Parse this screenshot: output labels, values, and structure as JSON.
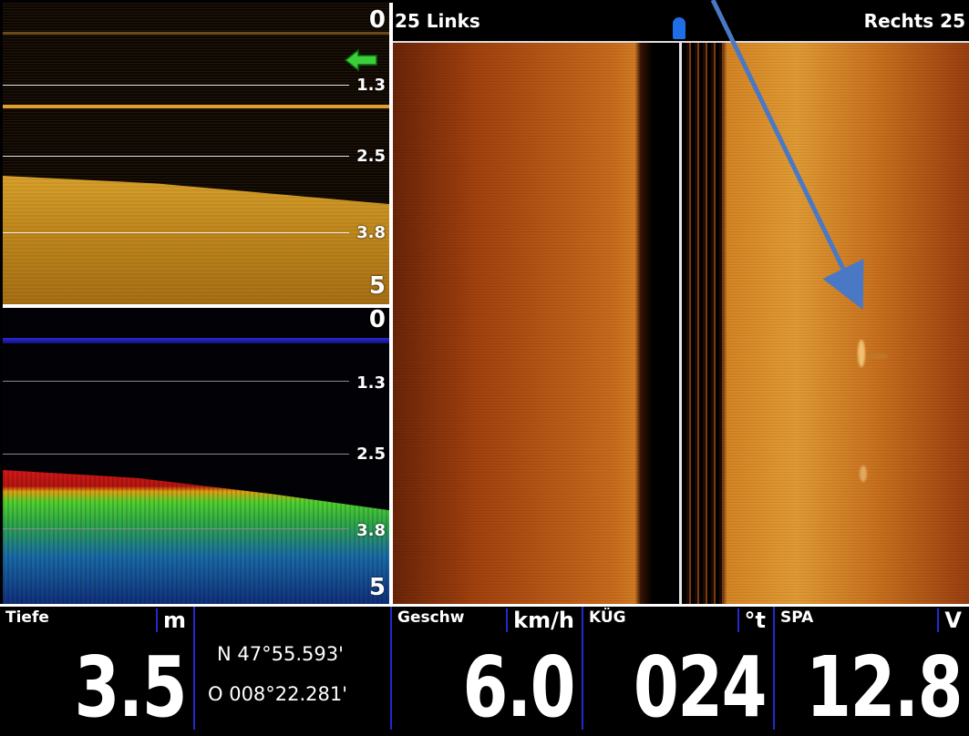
{
  "side_imaging": {
    "left_label": "25 Links",
    "right_label": "Rechts 25"
  },
  "down_imaging": {
    "depth_labels": [
      "0",
      "1.3",
      "2.5",
      "3.8",
      "5"
    ]
  },
  "sonar_2d": {
    "depth_labels": [
      "0",
      "1.3",
      "2.5",
      "3.8",
      "5"
    ]
  },
  "data_bar": {
    "depth": {
      "title": "Tiefe",
      "unit": "m",
      "value": "3.5"
    },
    "position": {
      "lat": "N 47°55.593'",
      "lon": "O 008°22.281'"
    },
    "speed": {
      "title": "Geschw",
      "unit": "km/h",
      "value": "6.0"
    },
    "course": {
      "title": "KÜG",
      "unit": "°t",
      "value": "024"
    },
    "voltage": {
      "title": "SPA",
      "unit": "V",
      "value": "12.8"
    }
  },
  "colors": {
    "annotation_arrow": "#4a78c4",
    "boat_marker": "#1e6ee8",
    "back_arrow": "#3ccf3c",
    "separator": "#1f2bd0"
  },
  "icons": {
    "back": "green-left-arrow-icon",
    "boat": "boat-position-marker-icon"
  }
}
